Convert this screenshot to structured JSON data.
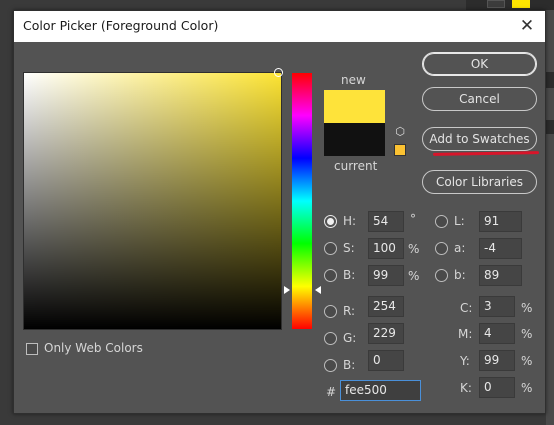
{
  "dialog": {
    "title": "Color Picker (Foreground Color)",
    "close_glyph": "✕"
  },
  "colors": {
    "new": "#fee33a",
    "current": "#111111",
    "gamut_warning": "#fbc232",
    "hue_base": "#fde433"
  },
  "swatch_labels": {
    "new": "new",
    "current": "current"
  },
  "buttons": {
    "ok": "OK",
    "cancel": "Cancel",
    "add_to_swatches": "Add to Swatches",
    "color_libraries": "Color Libraries"
  },
  "only_web_colors": {
    "label": "Only Web Colors",
    "checked": false
  },
  "hsb": {
    "h": {
      "label": "H:",
      "value": "54",
      "unit": "°",
      "selected": true
    },
    "s": {
      "label": "S:",
      "value": "100",
      "unit": "%",
      "selected": false
    },
    "b": {
      "label": "B:",
      "value": "99",
      "unit": "%",
      "selected": false
    }
  },
  "rgb": {
    "r": {
      "label": "R:",
      "value": "254"
    },
    "g": {
      "label": "G:",
      "value": "229"
    },
    "b": {
      "label": "B:",
      "value": "0"
    }
  },
  "lab": {
    "l": {
      "label": "L:",
      "value": "91"
    },
    "a": {
      "label": "a:",
      "value": "-4"
    },
    "b": {
      "label": "b:",
      "value": "89"
    }
  },
  "cmyk": {
    "c": {
      "label": "C:",
      "value": "3",
      "unit": "%"
    },
    "m": {
      "label": "M:",
      "value": "4",
      "unit": "%"
    },
    "y": {
      "label": "Y:",
      "value": "99",
      "unit": "%"
    },
    "k": {
      "label": "K:",
      "value": "0",
      "unit": "%"
    }
  },
  "hex": {
    "label": "#",
    "value": "fee500"
  },
  "icons": {
    "cube": "⬡"
  }
}
